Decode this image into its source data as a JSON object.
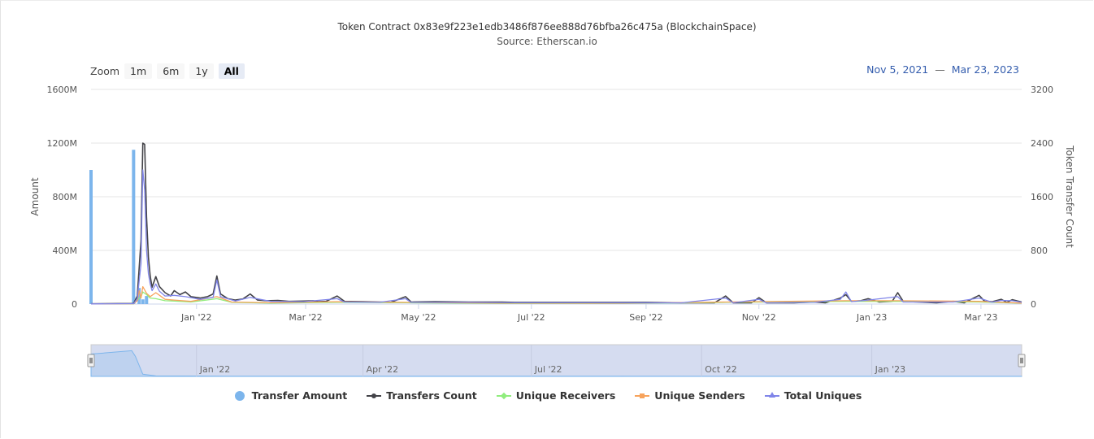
{
  "chart_data": {
    "type": "bar+line",
    "title": "Token Contract 0x83e9f223e1edb3486f876ee888d76bfba26c475a (BlockchainSpace)",
    "subtitle": "Source: Etherscan.io",
    "zoom": {
      "label": "Zoom",
      "buttons": [
        "1m",
        "6m",
        "1y",
        "All"
      ],
      "selected": "All"
    },
    "range": {
      "from": "Nov 5, 2021",
      "separator": "—",
      "to": "Mar 23, 2023"
    },
    "x_axis": {
      "type": "date",
      "range": [
        "2021-11-05",
        "2023-03-23"
      ],
      "ticks": [
        {
          "date": "2022-01-01",
          "label": "Jan '22"
        },
        {
          "date": "2022-03-01",
          "label": "Mar '22"
        },
        {
          "date": "2022-05-01",
          "label": "May '22"
        },
        {
          "date": "2022-07-01",
          "label": "Jul '22"
        },
        {
          "date": "2022-09-01",
          "label": "Sep '22"
        },
        {
          "date": "2022-11-01",
          "label": "Nov '22"
        },
        {
          "date": "2023-01-01",
          "label": "Jan '23"
        },
        {
          "date": "2023-03-01",
          "label": "Mar '23"
        }
      ]
    },
    "y_left": {
      "label": "Amount",
      "min": 0,
      "max": 1600000000,
      "ticks": [
        {
          "value": 0,
          "label": "0"
        },
        {
          "value": 400000000,
          "label": "400M"
        },
        {
          "value": 800000000,
          "label": "800M"
        },
        {
          "value": 1200000000,
          "label": "1200M"
        },
        {
          "value": 1600000000,
          "label": "1600M"
        }
      ]
    },
    "y_right": {
      "label": "Token Transfer Count",
      "min": 0,
      "max": 3200,
      "ticks": [
        {
          "value": 0,
          "label": "0"
        },
        {
          "value": 800,
          "label": "800"
        },
        {
          "value": 1600,
          "label": "1600"
        },
        {
          "value": 2400,
          "label": "2400"
        },
        {
          "value": 3200,
          "label": "3200"
        }
      ]
    },
    "grid": true,
    "legend_position": "bottom",
    "series": [
      {
        "name": "Transfer Amount",
        "type": "bar",
        "axis": "left",
        "color": "#7cb5ec",
        "points": [
          [
            "2021-11-05",
            1000000000
          ],
          [
            "2021-11-28",
            1150000000
          ],
          [
            "2021-12-01",
            120000000
          ],
          [
            "2021-12-03",
            35000000
          ],
          [
            "2021-12-05",
            60000000
          ]
        ]
      },
      {
        "name": "Transfers Count",
        "type": "line",
        "axis": "right",
        "color": "#434348",
        "points": [
          [
            "2021-11-05",
            4
          ],
          [
            "2021-11-28",
            8
          ],
          [
            "2021-11-30",
            120
          ],
          [
            "2021-12-02",
            950
          ],
          [
            "2021-12-03",
            2400
          ],
          [
            "2021-12-04",
            2380
          ],
          [
            "2021-12-05",
            1300
          ],
          [
            "2021-12-06",
            700
          ],
          [
            "2021-12-07",
            420
          ],
          [
            "2021-12-08",
            250
          ],
          [
            "2021-12-10",
            410
          ],
          [
            "2021-12-12",
            260
          ],
          [
            "2021-12-15",
            170
          ],
          [
            "2021-12-18",
            120
          ],
          [
            "2021-12-20",
            200
          ],
          [
            "2021-12-23",
            140
          ],
          [
            "2021-12-26",
            180
          ],
          [
            "2021-12-29",
            110
          ],
          [
            "2022-01-03",
            90
          ],
          [
            "2022-01-07",
            110
          ],
          [
            "2022-01-10",
            150
          ],
          [
            "2022-01-12",
            420
          ],
          [
            "2022-01-14",
            150
          ],
          [
            "2022-01-18",
            80
          ],
          [
            "2022-01-22",
            60
          ],
          [
            "2022-01-26",
            75
          ],
          [
            "2022-01-30",
            150
          ],
          [
            "2022-02-03",
            60
          ],
          [
            "2022-02-08",
            50
          ],
          [
            "2022-02-14",
            55
          ],
          [
            "2022-02-20",
            40
          ],
          [
            "2022-02-28",
            45
          ],
          [
            "2022-03-05",
            50
          ],
          [
            "2022-03-08",
            35
          ],
          [
            "2022-03-12",
            40
          ],
          [
            "2022-03-18",
            120
          ],
          [
            "2022-03-22",
            40
          ],
          [
            "2022-04-01",
            35
          ],
          [
            "2022-04-10",
            30
          ],
          [
            "2022-04-16",
            25
          ],
          [
            "2022-04-24",
            110
          ],
          [
            "2022-04-27",
            30
          ],
          [
            "2022-05-10",
            35
          ],
          [
            "2022-05-28",
            30
          ],
          [
            "2022-06-15",
            30
          ],
          [
            "2022-06-22",
            25
          ],
          [
            "2022-07-10",
            25
          ],
          [
            "2022-08-01",
            25
          ],
          [
            "2022-08-20",
            25
          ],
          [
            "2022-09-01",
            25
          ],
          [
            "2022-09-20",
            20
          ],
          [
            "2022-10-08",
            20
          ],
          [
            "2022-10-14",
            120
          ],
          [
            "2022-10-18",
            20
          ],
          [
            "2022-10-28",
            20
          ],
          [
            "2022-11-01",
            95
          ],
          [
            "2022-11-05",
            20
          ],
          [
            "2022-11-20",
            20
          ],
          [
            "2022-12-01",
            30
          ],
          [
            "2022-12-07",
            20
          ],
          [
            "2022-12-15",
            90
          ],
          [
            "2022-12-18",
            140
          ],
          [
            "2022-12-21",
            40
          ],
          [
            "2022-12-26",
            50
          ],
          [
            "2022-12-30",
            80
          ],
          [
            "2023-01-05",
            30
          ],
          [
            "2023-01-12",
            40
          ],
          [
            "2023-01-15",
            170
          ],
          [
            "2023-01-18",
            40
          ],
          [
            "2023-01-26",
            30
          ],
          [
            "2023-02-05",
            20
          ],
          [
            "2023-02-14",
            40
          ],
          [
            "2023-02-20",
            20
          ],
          [
            "2023-02-28",
            130
          ],
          [
            "2023-03-03",
            40
          ],
          [
            "2023-03-07",
            35
          ],
          [
            "2023-03-12",
            70
          ],
          [
            "2023-03-15",
            25
          ],
          [
            "2023-03-18",
            65
          ],
          [
            "2023-03-23",
            30
          ]
        ]
      },
      {
        "name": "Unique Receivers",
        "type": "line",
        "axis": "right",
        "color": "#90ed7d",
        "points": [
          [
            "2021-11-05",
            2
          ],
          [
            "2021-11-28",
            4
          ],
          [
            "2021-11-30",
            60
          ],
          [
            "2021-12-02",
            110
          ],
          [
            "2021-12-03",
            180
          ],
          [
            "2021-12-05",
            140
          ],
          [
            "2021-12-07",
            90
          ],
          [
            "2021-12-10",
            80
          ],
          [
            "2021-12-15",
            50
          ],
          [
            "2021-12-20",
            45
          ],
          [
            "2021-12-29",
            30
          ],
          [
            "2022-01-12",
            80
          ],
          [
            "2022-01-20",
            25
          ],
          [
            "2022-02-10",
            15
          ],
          [
            "2022-03-18",
            25
          ],
          [
            "2022-04-24",
            20
          ],
          [
            "2022-06-15",
            10
          ],
          [
            "2022-08-20",
            10
          ],
          [
            "2022-10-14",
            25
          ],
          [
            "2022-12-18",
            40
          ],
          [
            "2023-01-15",
            40
          ],
          [
            "2023-02-28",
            30
          ],
          [
            "2023-03-23",
            12
          ]
        ]
      },
      {
        "name": "Unique Senders",
        "type": "line",
        "axis": "right",
        "color": "#f7a35c",
        "points": [
          [
            "2021-11-05",
            2
          ],
          [
            "2021-11-28",
            5
          ],
          [
            "2021-11-30",
            50
          ],
          [
            "2021-12-01",
            200
          ],
          [
            "2021-12-02",
            90
          ],
          [
            "2021-12-03",
            260
          ],
          [
            "2021-12-05",
            160
          ],
          [
            "2021-12-07",
            110
          ],
          [
            "2021-12-10",
            170
          ],
          [
            "2021-12-15",
            70
          ],
          [
            "2021-12-20",
            60
          ],
          [
            "2021-12-29",
            40
          ],
          [
            "2022-01-12",
            110
          ],
          [
            "2022-01-20",
            30
          ],
          [
            "2022-02-10",
            20
          ],
          [
            "2022-03-18",
            35
          ],
          [
            "2022-04-24",
            25
          ],
          [
            "2022-06-15",
            15
          ],
          [
            "2022-08-20",
            12
          ],
          [
            "2022-10-14",
            30
          ],
          [
            "2022-12-18",
            50
          ],
          [
            "2023-01-15",
            50
          ],
          [
            "2023-02-28",
            40
          ],
          [
            "2023-03-23",
            15
          ]
        ]
      },
      {
        "name": "Total Uniques",
        "type": "line",
        "axis": "right",
        "color": "#8085e9",
        "points": [
          [
            "2021-11-05",
            3
          ],
          [
            "2021-11-28",
            6
          ],
          [
            "2021-11-30",
            80
          ],
          [
            "2021-12-02",
            600
          ],
          [
            "2021-12-03",
            2000
          ],
          [
            "2021-12-04",
            1700
          ],
          [
            "2021-12-05",
            800
          ],
          [
            "2021-12-06",
            450
          ],
          [
            "2021-12-07",
            300
          ],
          [
            "2021-12-08",
            200
          ],
          [
            "2021-12-10",
            300
          ],
          [
            "2021-12-12",
            190
          ],
          [
            "2021-12-15",
            120
          ],
          [
            "2021-12-20",
            130
          ],
          [
            "2021-12-26",
            110
          ],
          [
            "2022-01-03",
            70
          ],
          [
            "2022-01-10",
            100
          ],
          [
            "2022-01-12",
            360
          ],
          [
            "2022-01-14",
            110
          ],
          [
            "2022-01-22",
            45
          ],
          [
            "2022-01-30",
            100
          ],
          [
            "2022-02-10",
            40
          ],
          [
            "2022-02-28",
            35
          ],
          [
            "2022-03-18",
            80
          ],
          [
            "2022-03-22",
            30
          ],
          [
            "2022-04-10",
            25
          ],
          [
            "2022-04-24",
            80
          ],
          [
            "2022-04-27",
            25
          ],
          [
            "2022-05-28",
            25
          ],
          [
            "2022-06-22",
            20
          ],
          [
            "2022-08-01",
            20
          ],
          [
            "2022-09-20",
            18
          ],
          [
            "2022-10-14",
            90
          ],
          [
            "2022-10-18",
            18
          ],
          [
            "2022-11-01",
            70
          ],
          [
            "2022-11-05",
            18
          ],
          [
            "2022-12-01",
            25
          ],
          [
            "2022-12-15",
            70
          ],
          [
            "2022-12-18",
            180
          ],
          [
            "2022-12-21",
            35
          ],
          [
            "2022-12-30",
            60
          ],
          [
            "2023-01-15",
            110
          ],
          [
            "2023-01-18",
            30
          ],
          [
            "2023-02-14",
            30
          ],
          [
            "2023-02-28",
            90
          ],
          [
            "2023-03-07",
            28
          ],
          [
            "2023-03-12",
            55
          ],
          [
            "2023-03-18",
            50
          ],
          [
            "2023-03-23",
            25
          ]
        ]
      }
    ],
    "navigator": {
      "ticks": [
        {
          "date": "2022-01-01",
          "label": "Jan '22"
        },
        {
          "date": "2022-04-01",
          "label": "Apr '22"
        },
        {
          "date": "2022-07-01",
          "label": "Jul '22"
        },
        {
          "date": "2022-10-01",
          "label": "Oct '22"
        },
        {
          "date": "2023-01-01",
          "label": "Jan '23"
        }
      ],
      "series_points": [
        [
          "2021-11-05",
          1000000000
        ],
        [
          "2021-11-27",
          1150000000
        ],
        [
          "2021-11-29",
          900000000
        ],
        [
          "2021-12-03",
          100000000
        ],
        [
          "2021-12-10",
          20000000
        ],
        [
          "2022-01-15",
          10000000
        ],
        [
          "2023-03-23",
          5000000
        ]
      ]
    }
  }
}
